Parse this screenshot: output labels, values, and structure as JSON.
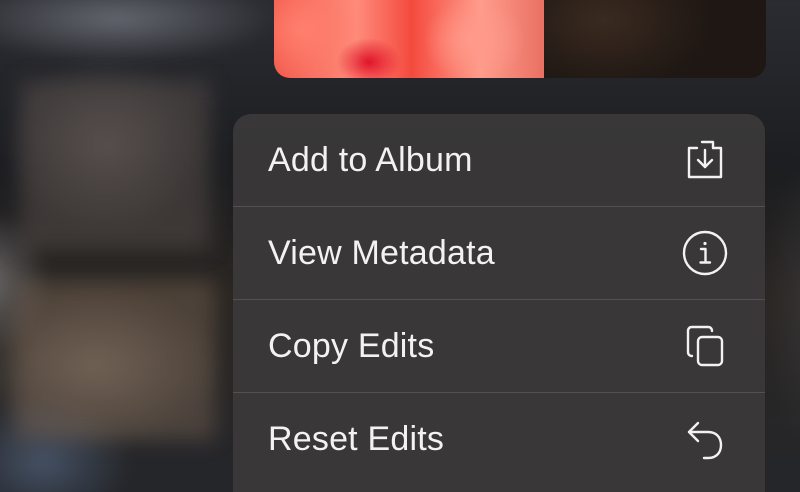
{
  "menu": {
    "items": [
      {
        "label": "Add to Album",
        "icon": "add-to-album-icon"
      },
      {
        "label": "View Metadata",
        "icon": "info-icon"
      },
      {
        "label": "Copy Edits",
        "icon": "copy-icon"
      },
      {
        "label": "Reset Edits",
        "icon": "revert-icon"
      }
    ]
  },
  "colors": {
    "menu_background": "#3a3838",
    "menu_text": "#f2f2f2",
    "separator": "#555454"
  }
}
